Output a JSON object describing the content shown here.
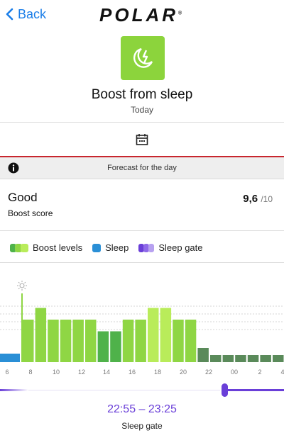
{
  "header": {
    "back_label": "Back",
    "brand": "POLAR"
  },
  "feature": {
    "title": "Boost from sleep",
    "subtitle": "Today"
  },
  "forecast": {
    "label": "Forecast for the day"
  },
  "score": {
    "rating": "Good",
    "label": "Boost score",
    "value": "9,6",
    "max": "/10"
  },
  "legend": {
    "boost": "Boost levels",
    "sleep": "Sleep",
    "gate": "Sleep gate"
  },
  "colors": {
    "accent": "#1a7de8",
    "boost_light": "#8fd644",
    "boost_dark": "#4fb24a",
    "boost_peak": "#b9ec5a",
    "sleep": "#2a8fd6",
    "post_sleep": "#5a8a5a",
    "gate": "#6a3fd8",
    "alert": "#c8262e"
  },
  "chart_data": {
    "type": "bar",
    "x_tick_labels": [
      "6",
      "8",
      "10",
      "12",
      "14",
      "16",
      "18",
      "20",
      "22",
      "00",
      "2",
      "4"
    ],
    "levels": [
      1,
      4,
      5,
      4,
      4,
      4,
      4,
      3,
      3,
      4,
      4,
      5,
      5,
      4,
      4,
      2,
      1,
      1,
      1,
      1,
      1,
      1,
      1
    ],
    "kinds": [
      "sleep",
      "boost",
      "boost",
      "boost",
      "boost",
      "boost",
      "boost",
      "boostdark",
      "boostdark",
      "boost",
      "boost",
      "peak",
      "peak",
      "boost",
      "boost",
      "post",
      "post",
      "post",
      "post",
      "post",
      "post",
      "post",
      "post"
    ],
    "ylim": [
      0,
      8
    ]
  },
  "gate": {
    "time": "22:55 – 23:25",
    "label": "Sleep gate"
  }
}
